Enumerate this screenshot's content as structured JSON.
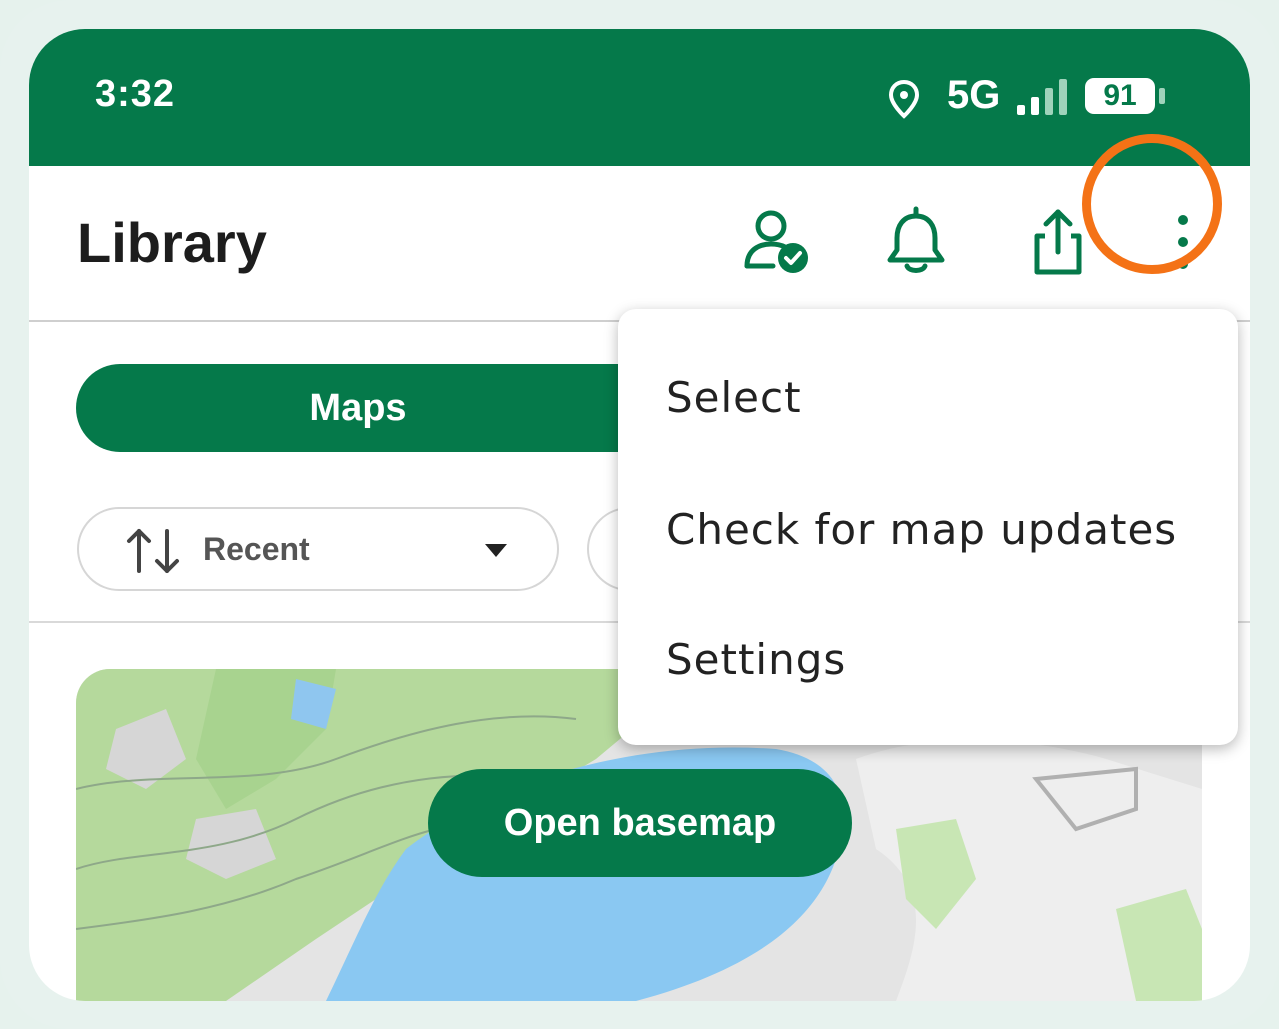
{
  "status_bar": {
    "time": "3:32",
    "network": "5G",
    "battery": "91",
    "icons": [
      "location-icon",
      "signal-icon",
      "battery-icon"
    ]
  },
  "app_bar": {
    "title": "Library",
    "actions": [
      "account-verified-icon",
      "bell-icon",
      "share-icon",
      "more-vert-icon"
    ]
  },
  "tabs": {
    "active": "Maps"
  },
  "sort": {
    "label": "Recent",
    "icon": "sort-arrows-icon"
  },
  "card": {
    "button": "Open basemap"
  },
  "overflow_menu": {
    "items": [
      "Select",
      "Check for map updates",
      "Settings"
    ]
  },
  "colors": {
    "brand": "#05794a",
    "highlight": "#f47216",
    "water": "#8ac8f2",
    "forest": "#b5d99c"
  }
}
